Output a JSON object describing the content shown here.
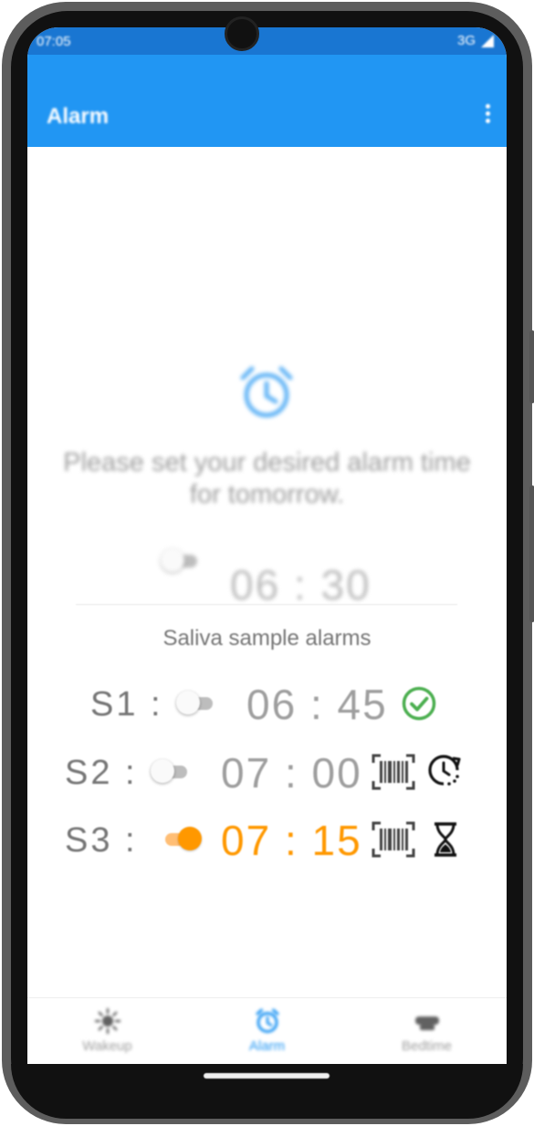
{
  "status_bar": {
    "time": "07:05",
    "network": "3G"
  },
  "app_bar": {
    "title": "Alarm",
    "menu_icon": "more-vert-icon"
  },
  "main_alarm": {
    "icon": "alarm-clock-icon",
    "prompt": "Please set your desired alarm time for tomorrow.",
    "enabled": false,
    "time": "06 : 30"
  },
  "saliva": {
    "title": "Saliva sample alarms",
    "alarms": [
      {
        "label": "S1 :",
        "enabled": false,
        "time": "06 : 45",
        "icons": [
          "check-circle-icon"
        ]
      },
      {
        "label": "S2 :",
        "enabled": false,
        "time": "07 : 00",
        "icons": [
          "barcode-scan-icon",
          "clock-reset-icon"
        ]
      },
      {
        "label": "S3 :",
        "enabled": true,
        "time": "07 : 15",
        "icons": [
          "barcode-scan-icon",
          "hourglass-icon"
        ]
      }
    ]
  },
  "bottom_nav": {
    "items": [
      {
        "label": "Wakeup",
        "icon": "sun-icon",
        "active": false
      },
      {
        "label": "Alarm",
        "icon": "alarm-icon",
        "active": true
      },
      {
        "label": "Bedtime",
        "icon": "sleep-icon",
        "active": false
      }
    ]
  },
  "colors": {
    "primary": "#2196f3",
    "status_bar": "#1976d2",
    "accent": "#ff9800",
    "success": "#4caf50",
    "muted": "#9e9e9e"
  }
}
